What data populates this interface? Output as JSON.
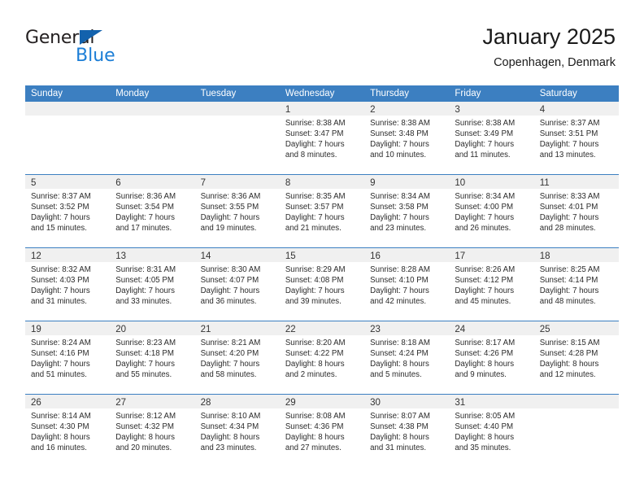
{
  "brand": {
    "name_part1": "General",
    "name_part2": "Blue",
    "triangle_color": "#1362ad",
    "blue_color": "#1c7ed6"
  },
  "header": {
    "title": "January 2025",
    "subtitle": "Copenhagen, Denmark"
  },
  "theme": {
    "header_row_bg": "#3c7fc1",
    "day_band_bg": "#f0f0f0",
    "grid_line": "#3c7fc1",
    "text": "#2b2b2b"
  },
  "weekdays": [
    "Sunday",
    "Monday",
    "Tuesday",
    "Wednesday",
    "Thursday",
    "Friday",
    "Saturday"
  ],
  "weeks": [
    [
      {
        "day": "",
        "lines": []
      },
      {
        "day": "",
        "lines": []
      },
      {
        "day": "",
        "lines": []
      },
      {
        "day": "1",
        "lines": [
          "Sunrise: 8:38 AM",
          "Sunset: 3:47 PM",
          "Daylight: 7 hours",
          "and 8 minutes."
        ]
      },
      {
        "day": "2",
        "lines": [
          "Sunrise: 8:38 AM",
          "Sunset: 3:48 PM",
          "Daylight: 7 hours",
          "and 10 minutes."
        ]
      },
      {
        "day": "3",
        "lines": [
          "Sunrise: 8:38 AM",
          "Sunset: 3:49 PM",
          "Daylight: 7 hours",
          "and 11 minutes."
        ]
      },
      {
        "day": "4",
        "lines": [
          "Sunrise: 8:37 AM",
          "Sunset: 3:51 PM",
          "Daylight: 7 hours",
          "and 13 minutes."
        ]
      }
    ],
    [
      {
        "day": "5",
        "lines": [
          "Sunrise: 8:37 AM",
          "Sunset: 3:52 PM",
          "Daylight: 7 hours",
          "and 15 minutes."
        ]
      },
      {
        "day": "6",
        "lines": [
          "Sunrise: 8:36 AM",
          "Sunset: 3:54 PM",
          "Daylight: 7 hours",
          "and 17 minutes."
        ]
      },
      {
        "day": "7",
        "lines": [
          "Sunrise: 8:36 AM",
          "Sunset: 3:55 PM",
          "Daylight: 7 hours",
          "and 19 minutes."
        ]
      },
      {
        "day": "8",
        "lines": [
          "Sunrise: 8:35 AM",
          "Sunset: 3:57 PM",
          "Daylight: 7 hours",
          "and 21 minutes."
        ]
      },
      {
        "day": "9",
        "lines": [
          "Sunrise: 8:34 AM",
          "Sunset: 3:58 PM",
          "Daylight: 7 hours",
          "and 23 minutes."
        ]
      },
      {
        "day": "10",
        "lines": [
          "Sunrise: 8:34 AM",
          "Sunset: 4:00 PM",
          "Daylight: 7 hours",
          "and 26 minutes."
        ]
      },
      {
        "day": "11",
        "lines": [
          "Sunrise: 8:33 AM",
          "Sunset: 4:01 PM",
          "Daylight: 7 hours",
          "and 28 minutes."
        ]
      }
    ],
    [
      {
        "day": "12",
        "lines": [
          "Sunrise: 8:32 AM",
          "Sunset: 4:03 PM",
          "Daylight: 7 hours",
          "and 31 minutes."
        ]
      },
      {
        "day": "13",
        "lines": [
          "Sunrise: 8:31 AM",
          "Sunset: 4:05 PM",
          "Daylight: 7 hours",
          "and 33 minutes."
        ]
      },
      {
        "day": "14",
        "lines": [
          "Sunrise: 8:30 AM",
          "Sunset: 4:07 PM",
          "Daylight: 7 hours",
          "and 36 minutes."
        ]
      },
      {
        "day": "15",
        "lines": [
          "Sunrise: 8:29 AM",
          "Sunset: 4:08 PM",
          "Daylight: 7 hours",
          "and 39 minutes."
        ]
      },
      {
        "day": "16",
        "lines": [
          "Sunrise: 8:28 AM",
          "Sunset: 4:10 PM",
          "Daylight: 7 hours",
          "and 42 minutes."
        ]
      },
      {
        "day": "17",
        "lines": [
          "Sunrise: 8:26 AM",
          "Sunset: 4:12 PM",
          "Daylight: 7 hours",
          "and 45 minutes."
        ]
      },
      {
        "day": "18",
        "lines": [
          "Sunrise: 8:25 AM",
          "Sunset: 4:14 PM",
          "Daylight: 7 hours",
          "and 48 minutes."
        ]
      }
    ],
    [
      {
        "day": "19",
        "lines": [
          "Sunrise: 8:24 AM",
          "Sunset: 4:16 PM",
          "Daylight: 7 hours",
          "and 51 minutes."
        ]
      },
      {
        "day": "20",
        "lines": [
          "Sunrise: 8:23 AM",
          "Sunset: 4:18 PM",
          "Daylight: 7 hours",
          "and 55 minutes."
        ]
      },
      {
        "day": "21",
        "lines": [
          "Sunrise: 8:21 AM",
          "Sunset: 4:20 PM",
          "Daylight: 7 hours",
          "and 58 minutes."
        ]
      },
      {
        "day": "22",
        "lines": [
          "Sunrise: 8:20 AM",
          "Sunset: 4:22 PM",
          "Daylight: 8 hours",
          "and 2 minutes."
        ]
      },
      {
        "day": "23",
        "lines": [
          "Sunrise: 8:18 AM",
          "Sunset: 4:24 PM",
          "Daylight: 8 hours",
          "and 5 minutes."
        ]
      },
      {
        "day": "24",
        "lines": [
          "Sunrise: 8:17 AM",
          "Sunset: 4:26 PM",
          "Daylight: 8 hours",
          "and 9 minutes."
        ]
      },
      {
        "day": "25",
        "lines": [
          "Sunrise: 8:15 AM",
          "Sunset: 4:28 PM",
          "Daylight: 8 hours",
          "and 12 minutes."
        ]
      }
    ],
    [
      {
        "day": "26",
        "lines": [
          "Sunrise: 8:14 AM",
          "Sunset: 4:30 PM",
          "Daylight: 8 hours",
          "and 16 minutes."
        ]
      },
      {
        "day": "27",
        "lines": [
          "Sunrise: 8:12 AM",
          "Sunset: 4:32 PM",
          "Daylight: 8 hours",
          "and 20 minutes."
        ]
      },
      {
        "day": "28",
        "lines": [
          "Sunrise: 8:10 AM",
          "Sunset: 4:34 PM",
          "Daylight: 8 hours",
          "and 23 minutes."
        ]
      },
      {
        "day": "29",
        "lines": [
          "Sunrise: 8:08 AM",
          "Sunset: 4:36 PM",
          "Daylight: 8 hours",
          "and 27 minutes."
        ]
      },
      {
        "day": "30",
        "lines": [
          "Sunrise: 8:07 AM",
          "Sunset: 4:38 PM",
          "Daylight: 8 hours",
          "and 31 minutes."
        ]
      },
      {
        "day": "31",
        "lines": [
          "Sunrise: 8:05 AM",
          "Sunset: 4:40 PM",
          "Daylight: 8 hours",
          "and 35 minutes."
        ]
      },
      {
        "day": "",
        "lines": []
      }
    ]
  ]
}
